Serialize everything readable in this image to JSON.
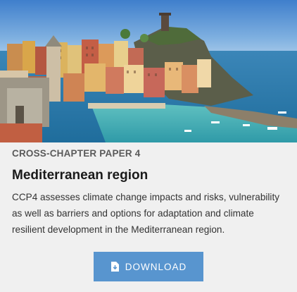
{
  "card": {
    "kicker": "CROSS-CHAPTER PAPER 4",
    "title": "Mediterranean region",
    "description": "CCP4 assesses climate change impacts and risks, vulnerability as well as barriers and options for adaptation and climate resilient development in the Mediterranean region.",
    "download_label": "DOWNLOAD",
    "download_icon": "file-download-icon"
  },
  "colors": {
    "button": "#5895cf",
    "background": "#f0f0f0",
    "sky": "#5a8fd0",
    "sea": "#2a7dab"
  }
}
